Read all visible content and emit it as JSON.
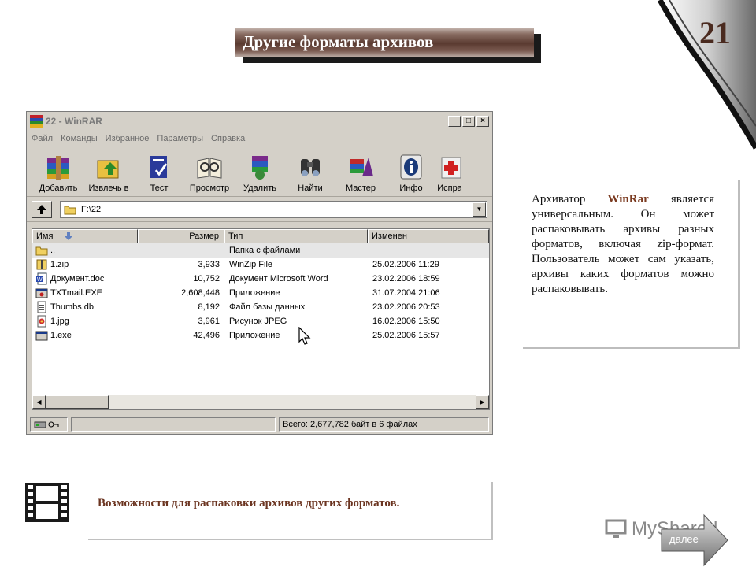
{
  "slide": {
    "title": "Другие форматы архивов",
    "page_number": "21",
    "caption": "Возможности для  распаковки архивов других форматов.",
    "watermark": "MyShared",
    "next_label": "далее"
  },
  "description": {
    "part1": "Архиватор ",
    "highlight": "WinRar",
    "part2": " является универсальным. Он может распаковывать архивы разных форматов, включая zip-формат. Пользователь может сам указать, архивы каких форматов можно распаковывать."
  },
  "window": {
    "title": "22 - WinRAR",
    "menu": [
      "Файл",
      "Команды",
      "Избранное",
      "Параметры",
      "Справка"
    ],
    "toolbar": [
      {
        "label": "Добавить",
        "icon": "add-archive-icon"
      },
      {
        "label": "Извлечь в",
        "icon": "extract-icon"
      },
      {
        "label": "Тест",
        "icon": "test-icon"
      },
      {
        "label": "Просмотр",
        "icon": "view-icon"
      },
      {
        "label": "Удалить",
        "icon": "delete-icon"
      },
      {
        "label": "Найти",
        "icon": "find-icon"
      },
      {
        "label": "Мастер",
        "icon": "wizard-icon"
      },
      {
        "label": "Инфо",
        "icon": "info-icon"
      },
      {
        "label": "Испра",
        "icon": "repair-icon"
      }
    ],
    "address": "F:\\22",
    "columns": {
      "name": "Имя",
      "size": "Размер",
      "type": "Тип",
      "modified": "Изменен"
    },
    "files": [
      {
        "name": "..",
        "size": "",
        "type": "Папка с файлами",
        "modified": ""
      },
      {
        "name": "1.zip",
        "size": "3,933",
        "type": "WinZip File",
        "modified": "25.02.2006 11:29"
      },
      {
        "name": "Документ.doc",
        "size": "10,752",
        "type": "Документ Microsoft Word",
        "modified": "23.02.2006 18:59"
      },
      {
        "name": "TXTmail.EXE",
        "size": "2,608,448",
        "type": "Приложение",
        "modified": "31.07.2004 21:06"
      },
      {
        "name": "Thumbs.db",
        "size": "8,192",
        "type": "Файл базы данных",
        "modified": "23.02.2006 20:53"
      },
      {
        "name": "1.jpg",
        "size": "3,961",
        "type": "Рисунок JPEG",
        "modified": "16.02.2006 15:50"
      },
      {
        "name": "1.exe",
        "size": "42,496",
        "type": "Приложение",
        "modified": "25.02.2006 15:57"
      }
    ],
    "status": "Всего: 2,677,782 байт в 6 файлах"
  },
  "colors": {
    "accent": "#7a3a20",
    "title_bar": "#5a3a30",
    "page_number": "#4a2a1f"
  }
}
